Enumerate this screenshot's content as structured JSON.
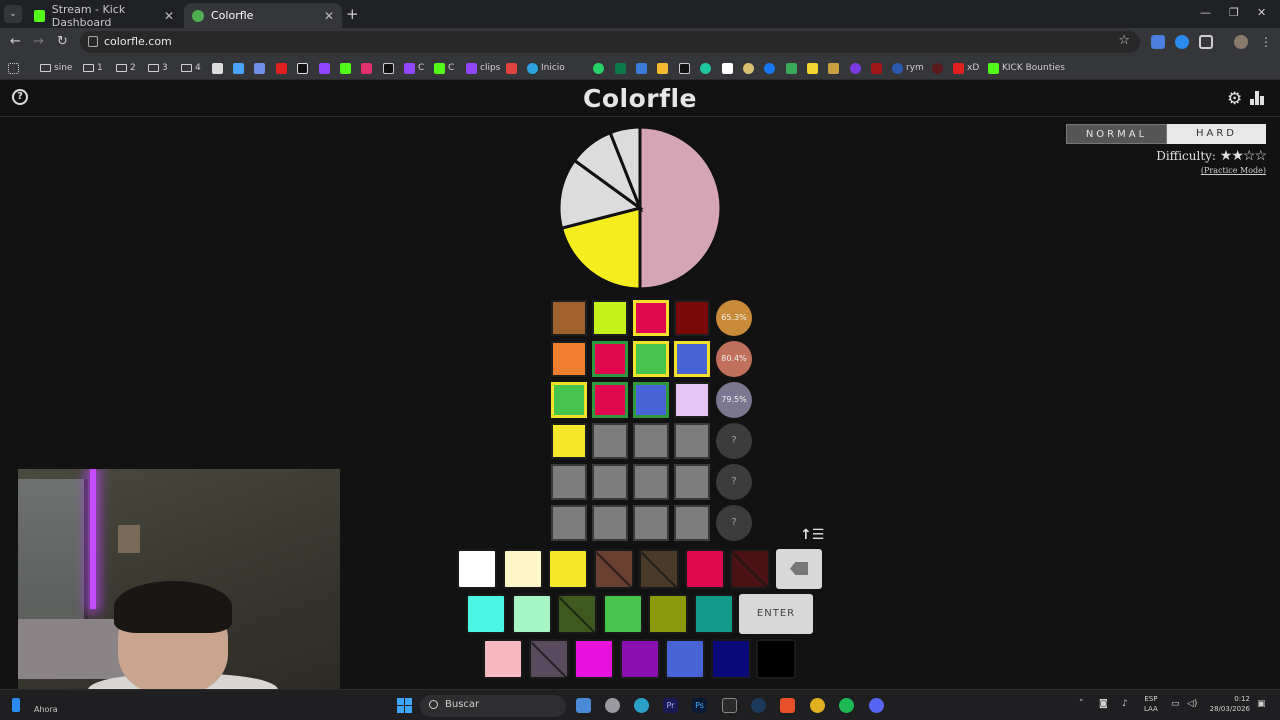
{
  "browser": {
    "tabs": [
      {
        "title": "Stream - Kick Dashboard",
        "favicon_color": "#53fc18",
        "active": false
      },
      {
        "title": "Colorfle",
        "favicon_color": "#4caf50",
        "active": true
      }
    ],
    "url": "colorfle.com",
    "bookmarks": [
      {
        "label": "sine",
        "icon": "folder-icon"
      },
      {
        "label": "1",
        "icon": "folder-icon"
      },
      {
        "label": "2",
        "icon": "folder-icon"
      },
      {
        "label": "3",
        "icon": "folder-icon"
      },
      {
        "label": "4",
        "icon": "folder-icon"
      },
      {
        "label": "C",
        "icon": "twitch-icon"
      },
      {
        "label": "C",
        "icon": "kick-icon"
      },
      {
        "label": "clips",
        "icon": "twitch-icon"
      },
      {
        "label": "Inicio",
        "icon": "telegram-icon"
      },
      {
        "label": "rym",
        "icon": "rym-icon"
      },
      {
        "label": "xD",
        "icon": "youtube-icon"
      },
      {
        "label": "KICK Bounties",
        "icon": "kick-icon"
      }
    ]
  },
  "game": {
    "title": "Colorfle",
    "modes": {
      "normal": "NORMAL",
      "hard": "HARD"
    },
    "difficulty_label": "Difficulty:",
    "difficulty_stars": "★★☆☆",
    "practice_link": "(Practice Mode)",
    "target_pie": [
      {
        "color": "#d4a5b5",
        "fraction": 0.5
      },
      {
        "color": "#f5ed1e",
        "fraction": 0.21
      },
      {
        "color": "#dcdcdc",
        "fraction": 0.14
      },
      {
        "color": "#dcdcdc",
        "fraction": 0.09
      },
      {
        "color": "#dcdcdc",
        "fraction": 0.06
      }
    ],
    "guesses": [
      {
        "cells": [
          {
            "color": "#a0622d",
            "hint": "none"
          },
          {
            "color": "#c6f31a",
            "hint": "none"
          },
          {
            "color": "#e0094f",
            "hint": "yellow"
          },
          {
            "color": "#7a0a0a",
            "hint": "none"
          }
        ],
        "score": "65.3%",
        "score_color": "#c98a3a"
      },
      {
        "cells": [
          {
            "color": "#f07f30",
            "hint": "none"
          },
          {
            "color": "#e0094f",
            "hint": "green"
          },
          {
            "color": "#46c44e",
            "hint": "yellow"
          },
          {
            "color": "#4763d6",
            "hint": "yellow"
          }
        ],
        "score": "80.4%",
        "score_color": "#c1705d"
      },
      {
        "cells": [
          {
            "color": "#46c44e",
            "hint": "yellow"
          },
          {
            "color": "#e0094f",
            "hint": "green"
          },
          {
            "color": "#4763d6",
            "hint": "green"
          },
          {
            "color": "#e7c4f4",
            "hint": "none"
          }
        ],
        "score": "79.5%",
        "score_color": "#7b7791"
      },
      {
        "cells": [
          {
            "color": "#f5e82a",
            "hint": "none"
          },
          {
            "color": "",
            "hint": "empty"
          },
          {
            "color": "",
            "hint": "empty"
          },
          {
            "color": "",
            "hint": "empty"
          }
        ],
        "score": "?",
        "score_color": ""
      },
      {
        "cells": [
          {
            "color": "",
            "hint": "empty"
          },
          {
            "color": "",
            "hint": "empty"
          },
          {
            "color": "",
            "hint": "empty"
          },
          {
            "color": "",
            "hint": "empty"
          }
        ],
        "score": "?",
        "score_color": ""
      },
      {
        "cells": [
          {
            "color": "",
            "hint": "empty"
          },
          {
            "color": "",
            "hint": "empty"
          },
          {
            "color": "",
            "hint": "empty"
          },
          {
            "color": "",
            "hint": "empty"
          }
        ],
        "score": "?",
        "score_color": ""
      }
    ],
    "keyboard": {
      "row1": [
        {
          "color": "#ffffff",
          "used": false
        },
        {
          "color": "#fdf7c8",
          "used": false
        },
        {
          "color": "#f5e82a",
          "used": false
        },
        {
          "color": "#6a4030",
          "used": true
        },
        {
          "color": "#4a3a28",
          "used": true
        },
        {
          "color": "#e0094f",
          "used": false
        },
        {
          "color": "#4a1212",
          "used": true
        }
      ],
      "row2": [
        {
          "color": "#4af5e4",
          "used": false
        },
        {
          "color": "#a8f5c4",
          "used": false
        },
        {
          "color": "#3e5a1e",
          "used": true
        },
        {
          "color": "#46c44e",
          "used": false
        },
        {
          "color": "#8a9a08",
          "used": false
        },
        {
          "color": "#129a8a",
          "used": false
        }
      ],
      "row3": [
        {
          "color": "#f8b8c0",
          "used": false
        },
        {
          "color": "#5a4a5e",
          "used": true
        },
        {
          "color": "#e612dc",
          "used": false
        },
        {
          "color": "#8a0fb0",
          "used": false
        },
        {
          "color": "#4763d6",
          "used": false
        },
        {
          "color": "#0a0a7a",
          "used": false
        },
        {
          "color": "#000000",
          "used": false
        }
      ],
      "enter_label": "ENTER"
    }
  },
  "taskbar": {
    "weather": "Ahora",
    "search_label": "Buscar",
    "lang_line1": "ESP",
    "lang_line2": "LAA",
    "time": "0:12",
    "date": "28/03/2026"
  }
}
